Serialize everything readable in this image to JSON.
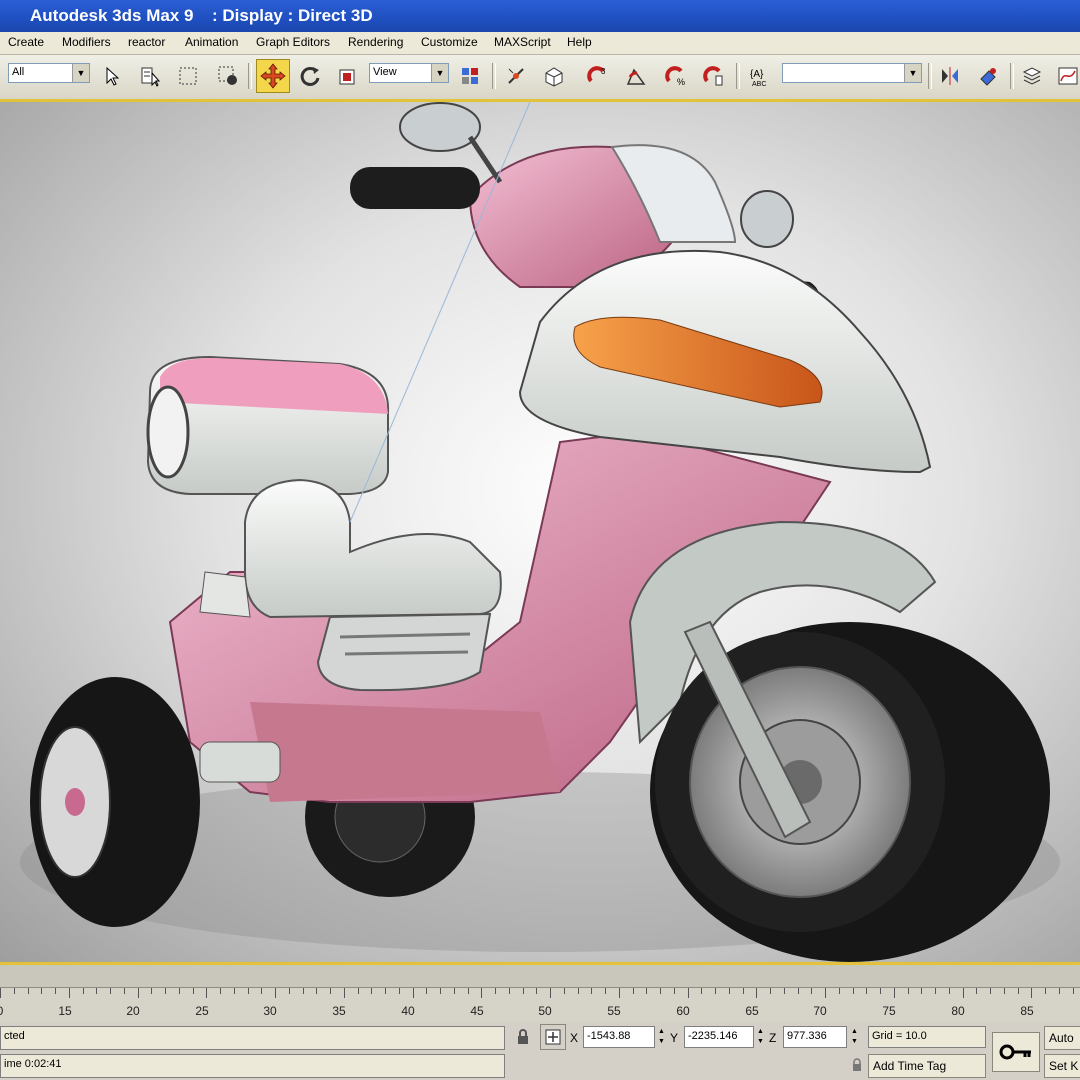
{
  "window": {
    "app_title": "Autodesk 3ds Max 9",
    "display_mode": ": Display : Direct 3D"
  },
  "menu": [
    "Create",
    "Modifiers",
    "reactor",
    "Animation",
    "Graph Editors",
    "Rendering",
    "Customize",
    "MAXScript",
    "Help"
  ],
  "toolbar": {
    "selection_filter": "All",
    "reference_coord": "View",
    "named_selection": ""
  },
  "timeline": {
    "ticks": [
      "0",
      "15",
      "20",
      "25",
      "30",
      "35",
      "40",
      "45",
      "50",
      "55",
      "60",
      "65",
      "70",
      "75",
      "80",
      "85"
    ]
  },
  "status": {
    "selection_text": "cted",
    "time_text": "ime  0:02:41",
    "x_label": "X",
    "x_value": "-1543.88",
    "y_label": "Y",
    "y_value": "-2235.146",
    "z_label": "Z",
    "z_value": "977.336",
    "grid": "Grid = 10.0",
    "add_time_tag": "Add Time Tag",
    "auto_key": "Auto",
    "set_key": "Set K"
  },
  "colors": {
    "accent_yellow": "#e2c23a",
    "scooter_pink": "#e7a3bf",
    "scooter_white": "#e9ece9",
    "tire": "#1a1a1a"
  }
}
